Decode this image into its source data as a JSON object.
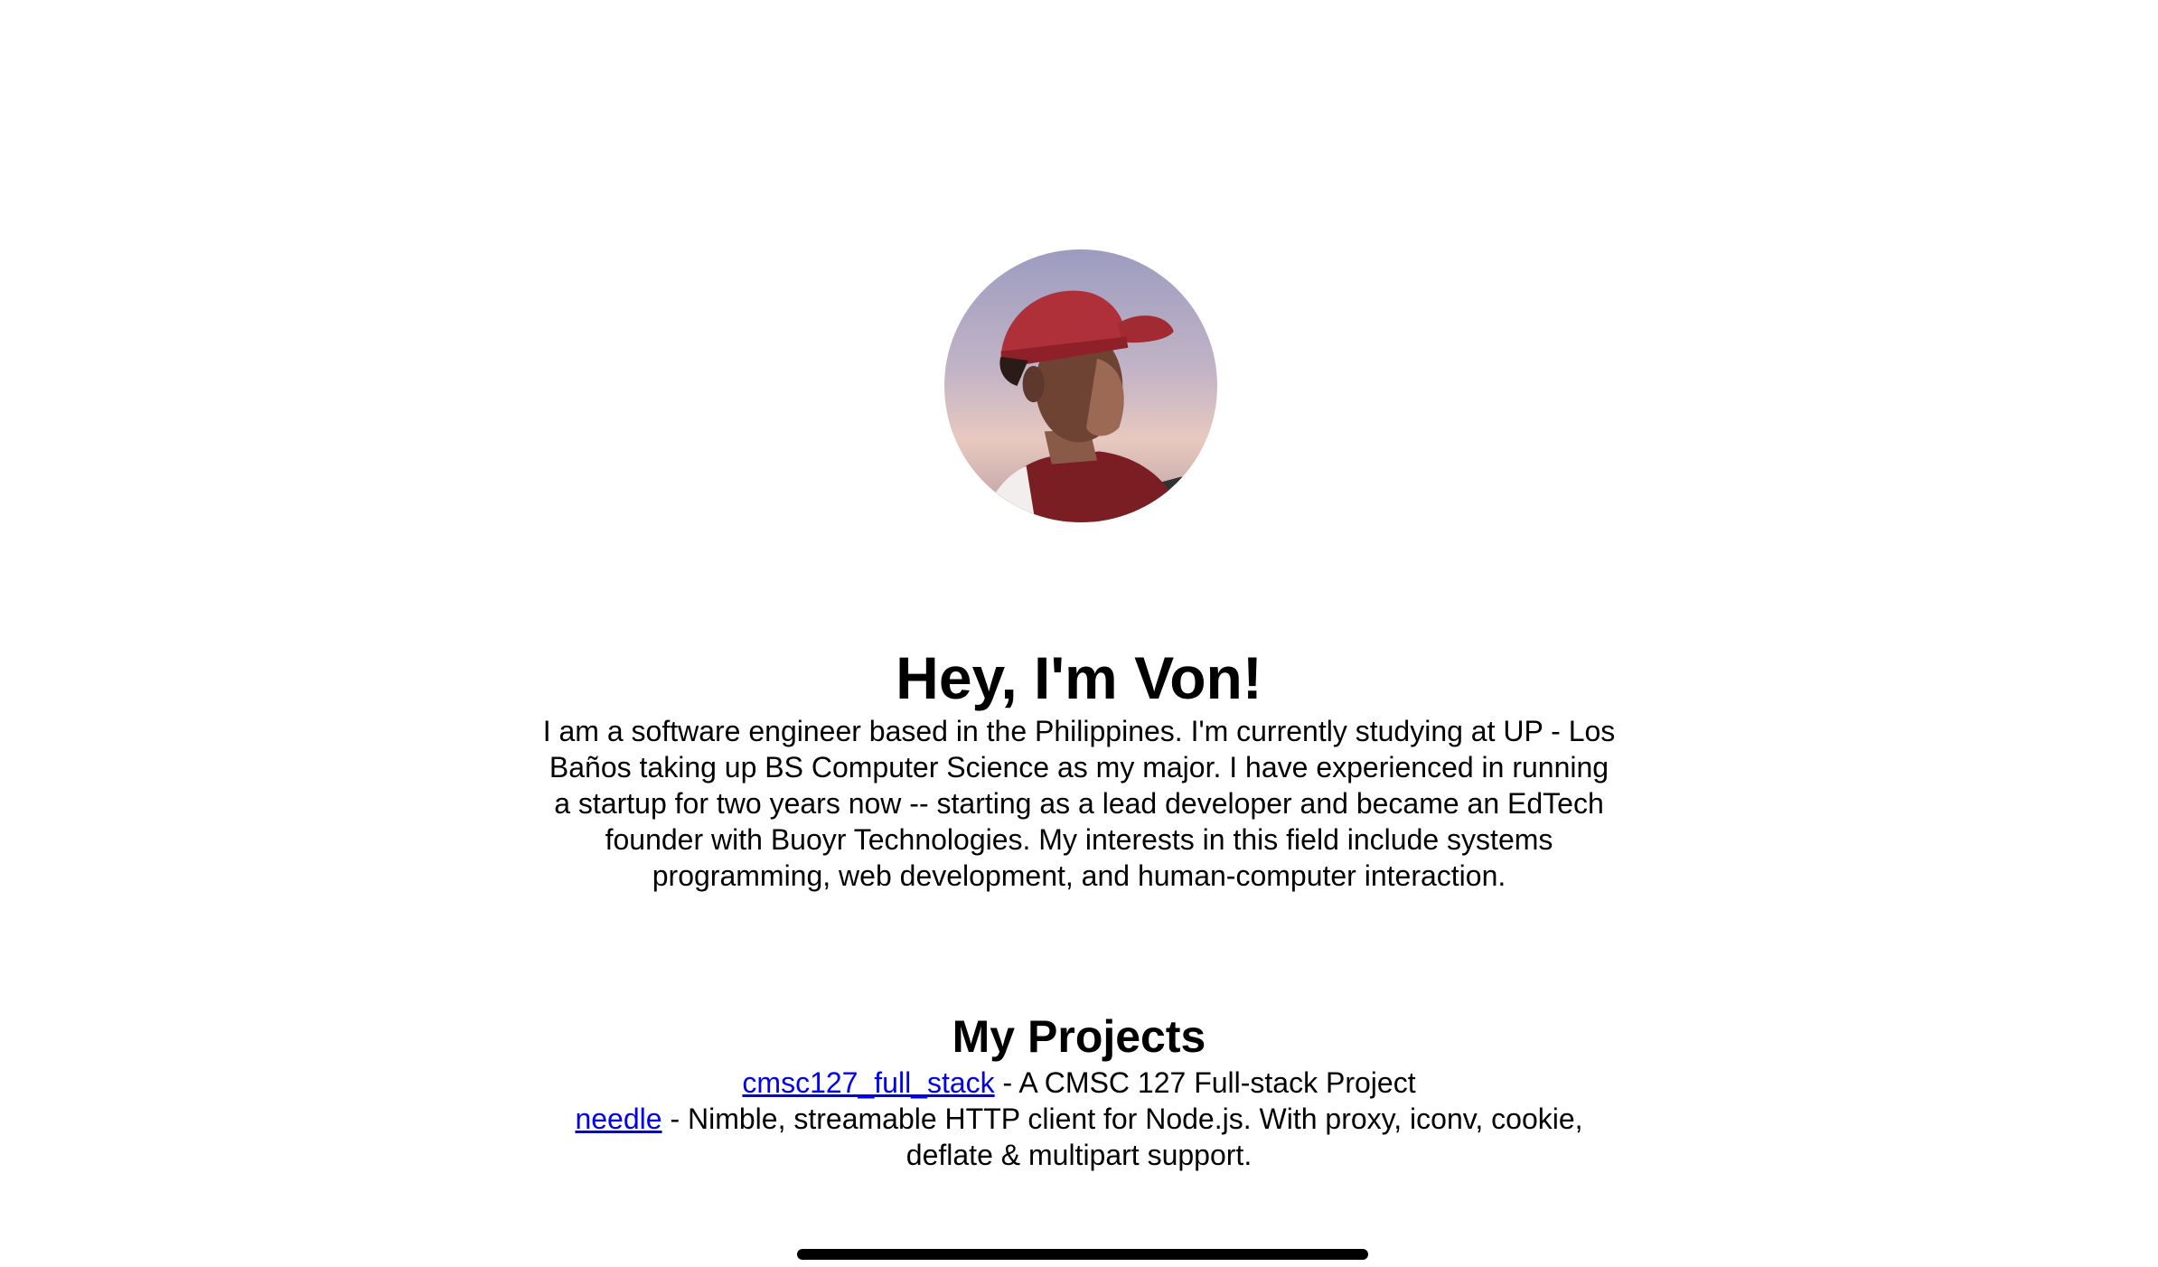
{
  "hero": {
    "title": "Hey, I'm Von!",
    "bio": "I am a software engineer based in the Philippines. I'm currently studying at UP - Los Baños taking up BS Computer Science as my major. I have experienced in running a startup for two years now -- starting as a lead developer and became an EdTech founder with Buoyr Technologies. My interests in this field include systems programming, web development, and human-computer interaction."
  },
  "projects": {
    "title": "My Projects",
    "items": [
      {
        "name": "cmsc127_full_stack",
        "description": " - A CMSC 127 Full-stack Project"
      },
      {
        "name": "needle",
        "description": " - Nimble, streamable HTTP client for Node.js. With proxy, iconv, cookie, deflate & multipart support."
      }
    ]
  },
  "colors": {
    "link": "#0000ee",
    "text": "#000000",
    "background": "#ffffff",
    "cap": "#b0303a"
  }
}
